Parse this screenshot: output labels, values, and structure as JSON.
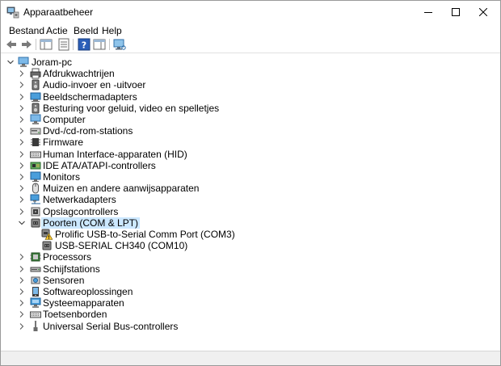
{
  "window": {
    "title": "Apparaatbeheer"
  },
  "menu": [
    "Bestand",
    "Actie",
    "Beeld",
    "Help"
  ],
  "tree": {
    "root": "Joram-pc",
    "categories": [
      {
        "label": "Afdrukwachtrijen",
        "icon": "printer-icon"
      },
      {
        "label": "Audio-invoer en -uitvoer",
        "icon": "speaker-icon"
      },
      {
        "label": "Beeldschermadapters",
        "icon": "display-adapter-icon"
      },
      {
        "label": "Besturing voor geluid, video en spelletjes",
        "icon": "speaker-icon"
      },
      {
        "label": "Computer",
        "icon": "computer-icon"
      },
      {
        "label": "Dvd-/cd-rom-stations",
        "icon": "disc-drive-icon"
      },
      {
        "label": "Firmware",
        "icon": "chip-icon"
      },
      {
        "label": "Human Interface-apparaten (HID)",
        "icon": "keyboard-icon"
      },
      {
        "label": "IDE ATA/ATAPI-controllers",
        "icon": "controller-icon"
      },
      {
        "label": "Monitors",
        "icon": "monitor-icon"
      },
      {
        "label": "Muizen en andere aanwijsapparaten",
        "icon": "mouse-icon"
      },
      {
        "label": "Netwerkadapters",
        "icon": "network-icon"
      },
      {
        "label": "Opslagcontrollers",
        "icon": "storage-controller-icon"
      },
      {
        "label": "Poorten (COM & LPT)",
        "icon": "port-icon",
        "expanded": true,
        "selected": true,
        "children": [
          {
            "label": "Prolific USB-to-Serial Comm Port (COM3)",
            "icon": "port-warning-icon"
          },
          {
            "label": "USB-SERIAL CH340 (COM10)",
            "icon": "port-icon"
          }
        ]
      },
      {
        "label": "Processors",
        "icon": "processor-icon"
      },
      {
        "label": "Schijfstations",
        "icon": "disk-drive-icon"
      },
      {
        "label": "Sensoren",
        "icon": "sensor-icon"
      },
      {
        "label": "Softwareoplossingen",
        "icon": "software-icon"
      },
      {
        "label": "Systeemapparaten",
        "icon": "system-device-icon"
      },
      {
        "label": "Toetsenborden",
        "icon": "keyboard-icon"
      },
      {
        "label": "Universal Serial Bus-controllers",
        "icon": "usb-icon"
      }
    ]
  }
}
